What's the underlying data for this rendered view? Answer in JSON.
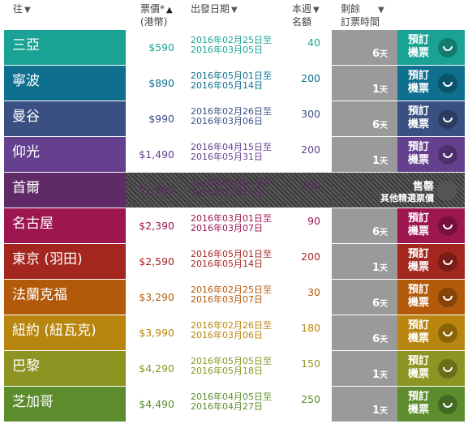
{
  "header": {
    "destination": "往",
    "price_line1": "票價*",
    "price_line2": "(港幣)",
    "dates": "出發日期",
    "quota_line1": "本週",
    "quota_line2": "名額",
    "remaining_line1": "剩餘",
    "remaining_line2": "訂票時間",
    "sort_down": "▼",
    "sort_up": "▲"
  },
  "days_unit": "天",
  "book_label_line1": "預訂",
  "book_label_line2": "機票",
  "date_to": "至",
  "rows": [
    {
      "dest": "三亞",
      "price": "$590",
      "date_from": "2016年02月25日",
      "date_to": "2016年03月05日",
      "quota": "40",
      "days": "6",
      "color": "#1aa394",
      "status": "available"
    },
    {
      "dest": "寧波",
      "price": "$890",
      "date_from": "2016年05月01日",
      "date_to": "2016年05月14日",
      "quota": "200",
      "days": "1",
      "color": "#0e6f8f",
      "status": "available"
    },
    {
      "dest": "曼谷",
      "price": "$990",
      "date_from": "2016年02月26日",
      "date_to": "2016年03月06日",
      "quota": "300",
      "days": "6",
      "color": "#3a4f82",
      "status": "available"
    },
    {
      "dest": "仰光",
      "price": "$1,490",
      "date_from": "2016年04月15日",
      "date_to": "2016年05月31日",
      "quota": "200",
      "days": "1",
      "color": "#64408f",
      "status": "available"
    },
    {
      "dest": "首爾",
      "price": "$1,990",
      "date_from": "2016年05月01日",
      "date_to": "2016年05月14日",
      "quota": "200",
      "days": "",
      "color": "#5f2a66",
      "status": "soldout",
      "soldout_line1": "售罄",
      "soldout_line2": "其他精選票價"
    },
    {
      "dest": "名古屋",
      "price": "$2,390",
      "date_from": "2016年03月01日",
      "date_to": "2016年03月07日",
      "quota": "90",
      "days": "6",
      "color": "#9d1650",
      "status": "available"
    },
    {
      "dest": "東京 (羽田)",
      "price": "$2,590",
      "date_from": "2016年05月01日",
      "date_to": "2016年05月14日",
      "quota": "200",
      "days": "1",
      "color": "#a3261f",
      "status": "available"
    },
    {
      "dest": "法蘭克福",
      "price": "$3,290",
      "date_from": "2016年02月25日",
      "date_to": "2016年03月07日",
      "quota": "30",
      "days": "6",
      "color": "#b35a0a",
      "status": "available"
    },
    {
      "dest": "紐約 (紐瓦克)",
      "price": "$3,990",
      "date_from": "2016年02月26日",
      "date_to": "2016年03月06日",
      "quota": "180",
      "days": "6",
      "color": "#b8860e",
      "status": "available"
    },
    {
      "dest": "巴黎",
      "price": "$4,290",
      "date_from": "2016年05月05日",
      "date_to": "2016年05月18日",
      "quota": "150",
      "days": "1",
      "color": "#8d9422",
      "status": "available"
    },
    {
      "dest": "芝加哥",
      "price": "$4,490",
      "date_from": "2016年04月05日",
      "date_to": "2016年04月27日",
      "quota": "250",
      "days": "1",
      "color": "#5c8c2c",
      "status": "available"
    }
  ]
}
